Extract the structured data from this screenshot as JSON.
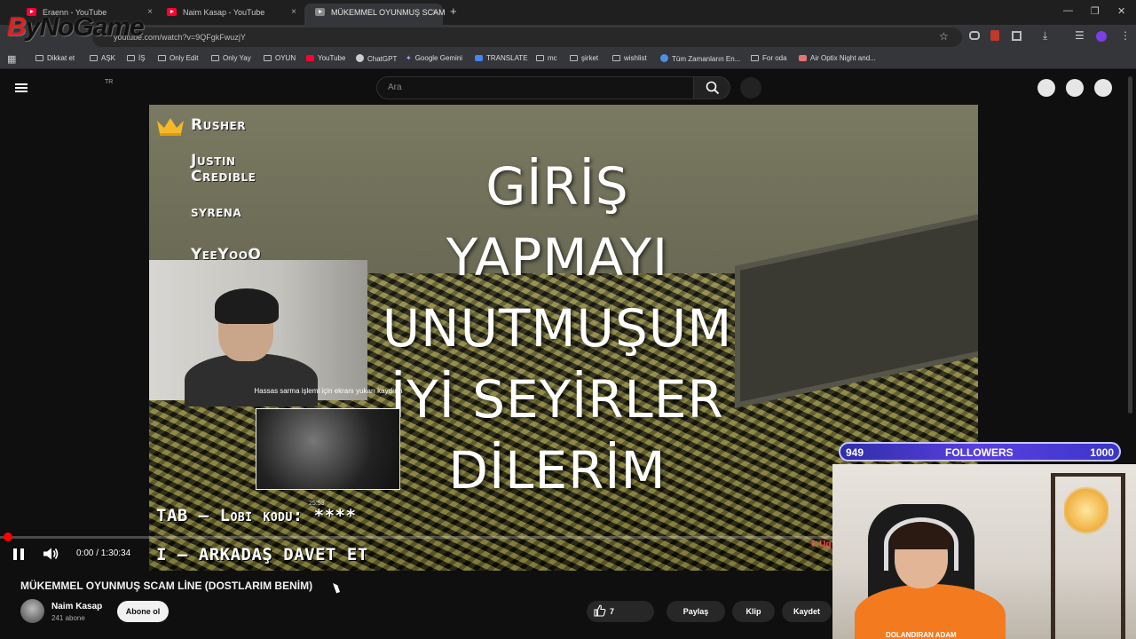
{
  "browser": {
    "tabs": [
      {
        "label": "Eraenn - YouTube"
      },
      {
        "label": "Naim Kasap - YouTube"
      },
      {
        "label": "MÜKEMMEL OYUNMUŞ SCAM"
      }
    ],
    "new_tab": "+",
    "close_glyph": "×",
    "window_controls": [
      "—",
      "❐",
      "✕"
    ],
    "url": "youtube.com/watch?v=9QFgkFwuzjY",
    "bookmarks": [
      {
        "label": "Dikkat et",
        "icon": "folder-icon"
      },
      {
        "label": "AŞK",
        "icon": "folder-icon"
      },
      {
        "label": "İŞ",
        "icon": "folder-icon"
      },
      {
        "label": "Only Edit",
        "icon": "folder-icon"
      },
      {
        "label": "Only Yay",
        "icon": "folder-icon"
      },
      {
        "label": "OYUN",
        "icon": "folder-icon"
      },
      {
        "label": "YouTube",
        "icon": "youtube-icon"
      },
      {
        "label": "ChatGPT",
        "icon": "chatgpt-icon"
      },
      {
        "label": "Google Gemini",
        "icon": "gemini-icon"
      },
      {
        "label": "TRANSLATE",
        "icon": "translate-icon"
      },
      {
        "label": "mc",
        "icon": "folder-icon"
      },
      {
        "label": "şirket",
        "icon": "folder-icon"
      },
      {
        "label": "wishlist",
        "icon": "folder-icon"
      },
      {
        "label": "Tüm Zamanların En...",
        "icon": "site-icon"
      },
      {
        "label": "For oda",
        "icon": "folder-icon"
      },
      {
        "label": "Air Optix Night and...",
        "icon": "site-icon"
      }
    ]
  },
  "overlay_logo": {
    "prefix": "B",
    "rest": "yNoGame"
  },
  "header": {
    "country_code": "TR",
    "search_placeholder": "Ara"
  },
  "video": {
    "leaderboard": [
      "Rusher",
      "Justin Credible",
      "syrena",
      "YeeYooO"
    ],
    "big_text_lines": [
      "GİRİŞ",
      "YAPMAYI",
      "UNUTMUŞUM",
      "İYİ SEYİRLER",
      "DİLERİM"
    ],
    "bottom_lines": [
      "TAB – Lobi kodu: ****",
      "I – ARKADAŞ DAVET ET"
    ],
    "mini_tip": "Hassas sarma işlemi için ekranı yukarı kaydırın",
    "mini_time": "25:53",
    "time_display": "0:00 / 1:30:34",
    "progress_fraction": 0.0,
    "cta_right": "⇞ Ug",
    "followers": {
      "current": "949",
      "label": "FOLLOWERS",
      "goal": "1000"
    },
    "webcam2_caption": "DOLANDIRAN ADAM"
  },
  "meta": {
    "title": "MÜKEMMEL OYUNMUŞ SCAM LİNE (DOSTLARIM BENİM)",
    "channel": "Naim Kasap",
    "subscribers": "241 abone",
    "subscribe_label": "Abone ol",
    "like_count": "7",
    "share_label": "Paylaş",
    "clip_label": "Klip",
    "save_label": "Kaydet"
  },
  "colors": {
    "accent": "#ff0033",
    "followers_bar": "#5b3fe0"
  }
}
